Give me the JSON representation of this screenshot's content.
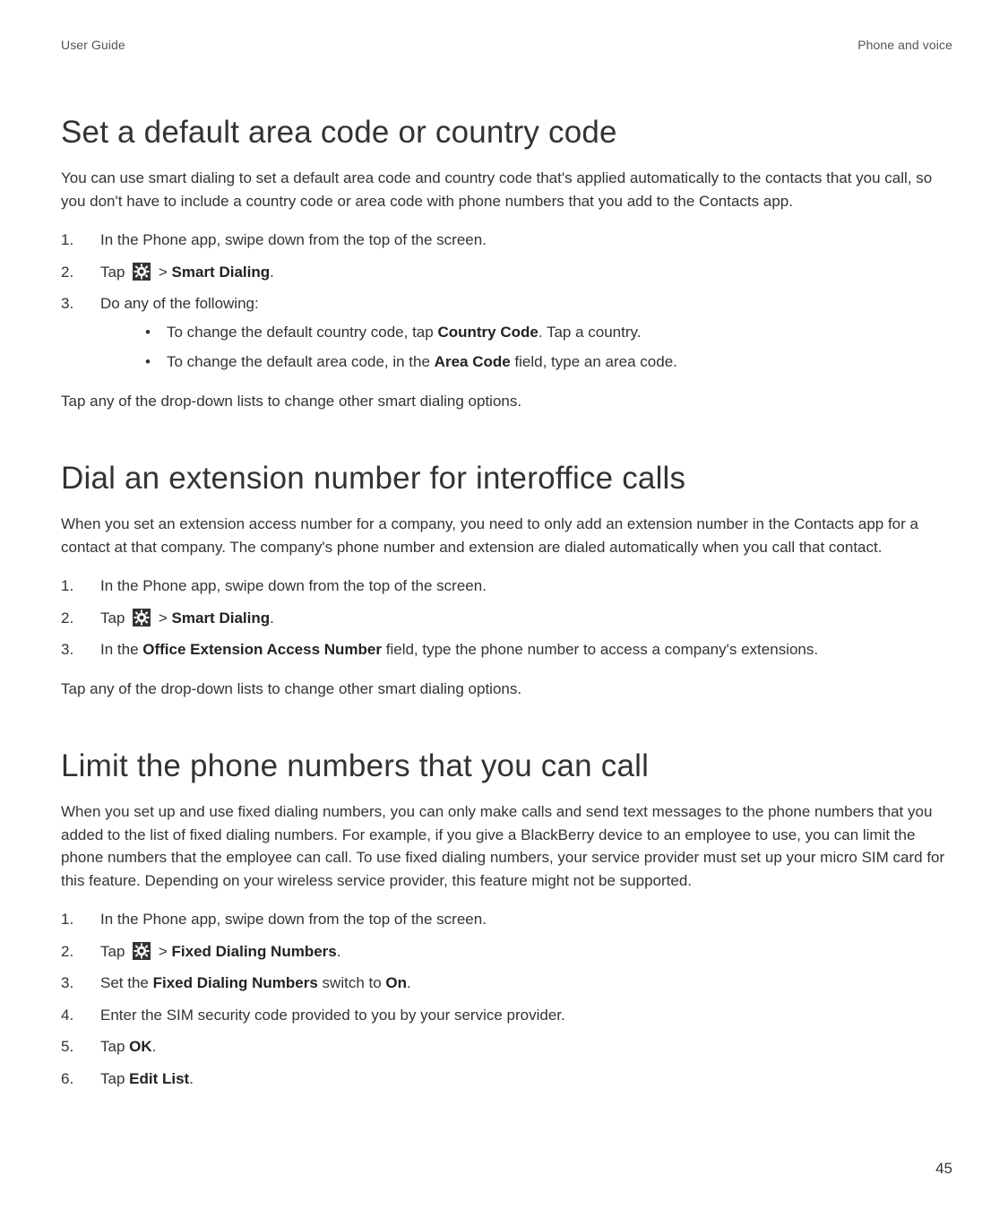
{
  "header": {
    "left": "User Guide",
    "right": "Phone and voice"
  },
  "sections": {
    "s1": {
      "heading": "Set a default area code or country code",
      "intro": "You can use smart dialing to set a default area code and country code that's applied automatically to the contacts that you call, so you don't have to include a country code or area code with phone numbers that you add to the Contacts app.",
      "step1_num": "1.",
      "step1_text": "In the Phone app, swipe down from the top of the screen.",
      "step2_num": "2.",
      "step2_pre": "Tap ",
      "step2_sep": " > ",
      "step2_bold": "Smart Dialing",
      "step2_period": ".",
      "step3_num": "3.",
      "step3_text": "Do any of the following:",
      "bullet1_pre": "To change the default country code, tap ",
      "bullet1_bold": "Country Code",
      "bullet1_post": ". Tap a country.",
      "bullet2_pre": "To change the default area code, in the ",
      "bullet2_bold": "Area Code",
      "bullet2_post": " field, type an area code.",
      "outro": "Tap any of the drop-down lists to change other smart dialing options."
    },
    "s2": {
      "heading": "Dial an extension number for interoffice calls",
      "intro": "When you set an extension access number for a company, you need to only add an extension number in the Contacts app for a contact at that company. The company's phone number and extension are dialed automatically when you call that contact.",
      "step1_num": "1.",
      "step1_text": "In the Phone app, swipe down from the top of the screen.",
      "step2_num": "2.",
      "step2_pre": "Tap ",
      "step2_sep": " > ",
      "step2_bold": "Smart Dialing",
      "step2_period": ".",
      "step3_num": "3.",
      "step3_pre": "In the ",
      "step3_bold": "Office Extension Access Number",
      "step3_post": " field, type the phone number to access a company's extensions.",
      "outro": "Tap any of the drop-down lists to change other smart dialing options."
    },
    "s3": {
      "heading": "Limit the phone numbers that you can call",
      "intro": "When you set up and use fixed dialing numbers, you can only make calls and send text messages to the phone numbers that you added to the list of fixed dialing numbers. For example, if you give a BlackBerry device to an employee to use, you can limit the phone numbers that the employee can call. To use fixed dialing numbers, your service provider must set up your micro SIM card for this feature. Depending on your wireless service provider, this feature might not be supported.",
      "step1_num": "1.",
      "step1_text": "In the Phone app, swipe down from the top of the screen.",
      "step2_num": "2.",
      "step2_pre": "Tap ",
      "step2_sep": " > ",
      "step2_bold": "Fixed Dialing Numbers",
      "step2_period": ".",
      "step3_num": "3.",
      "step3_pre": "Set the ",
      "step3_bold": "Fixed Dialing Numbers",
      "step3_mid": " switch to ",
      "step3_bold2": "On",
      "step3_period": ".",
      "step4_num": "4.",
      "step4_text": "Enter the SIM security code provided to you by your service provider.",
      "step5_num": "5.",
      "step5_pre": "Tap ",
      "step5_bold": "OK",
      "step5_period": ".",
      "step6_num": "6.",
      "step6_pre": "Tap ",
      "step6_bold": "Edit List",
      "step6_period": "."
    }
  },
  "icons": {
    "gear": "gear-icon"
  },
  "page_number": "45"
}
